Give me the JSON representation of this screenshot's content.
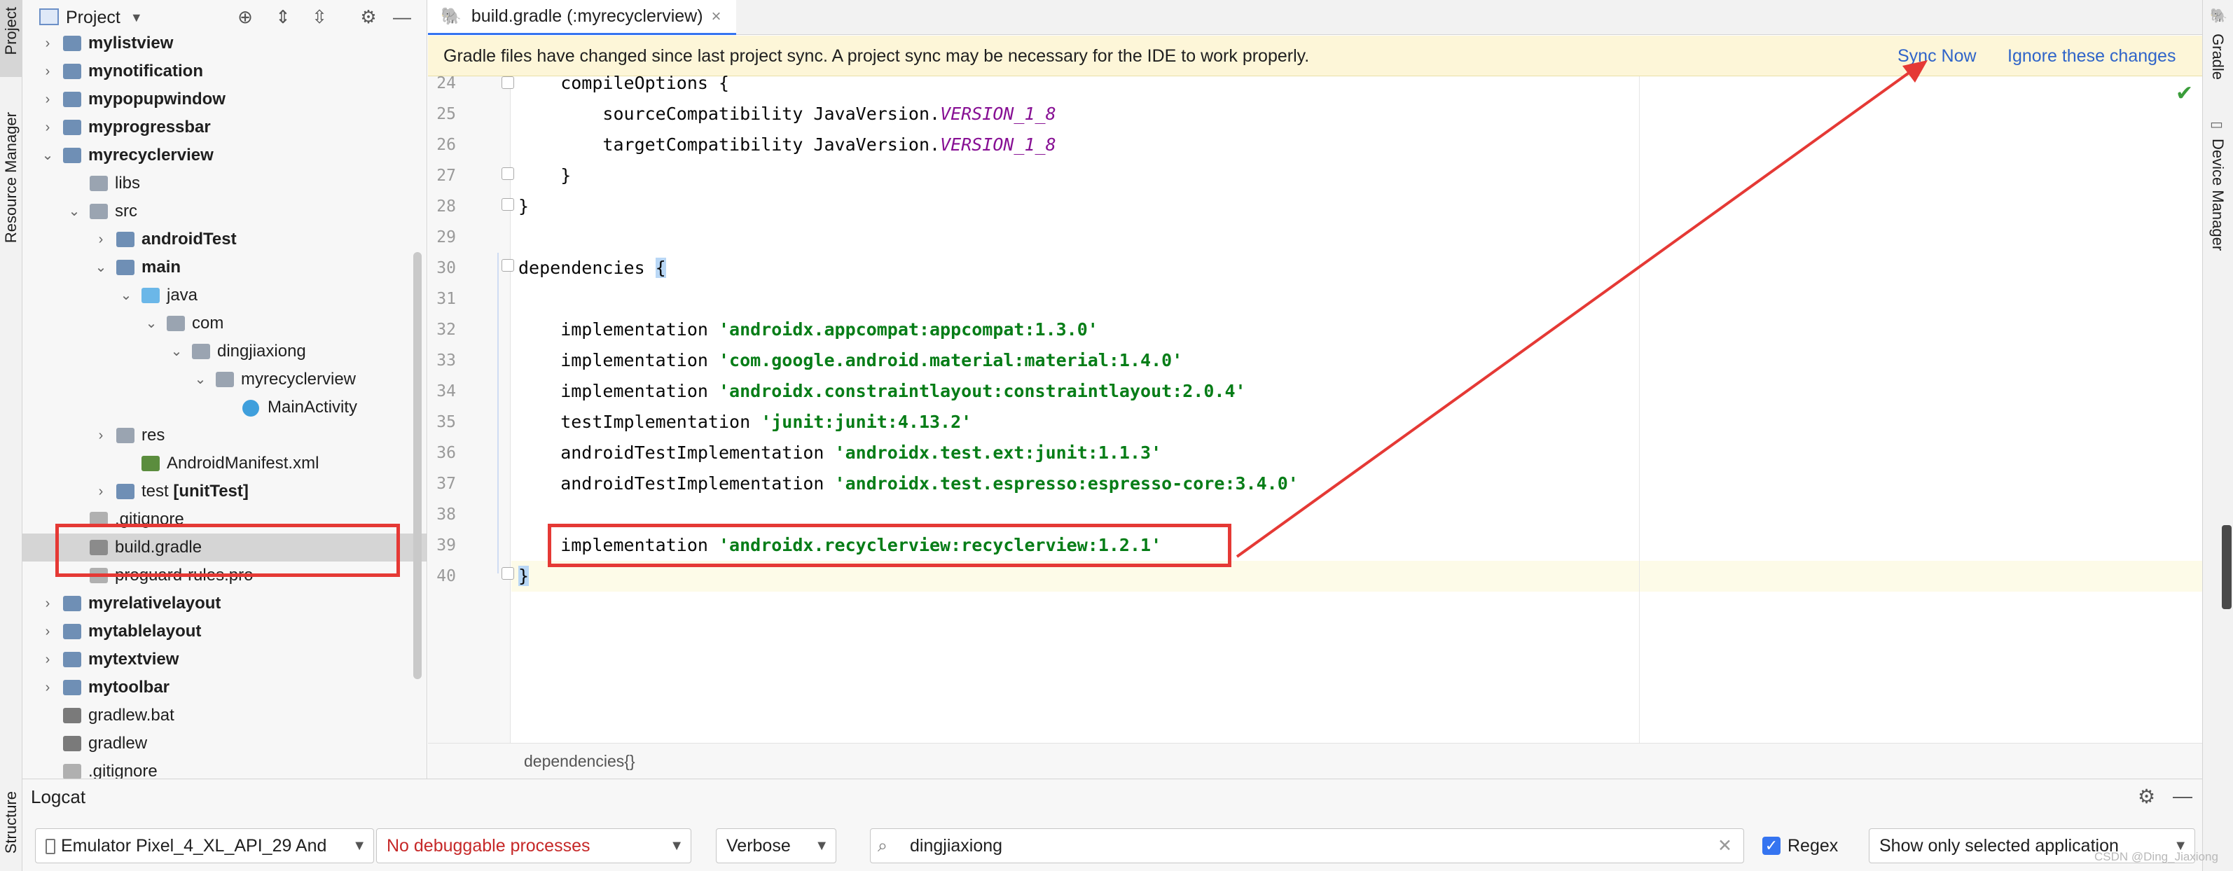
{
  "left_strip": {
    "project": "Project",
    "resource_manager": "Resource Manager",
    "structure": "Structure"
  },
  "project_panel": {
    "title": "Project",
    "tree": [
      {
        "label": "mylistview",
        "bold": true,
        "chevron": "›"
      },
      {
        "label": "mynotification",
        "bold": true,
        "chevron": "›"
      },
      {
        "label": "mypopupwindow",
        "bold": true,
        "chevron": "›"
      },
      {
        "label": "myprogressbar",
        "bold": true,
        "chevron": "›"
      },
      {
        "label": "myrecyclerview",
        "bold": true,
        "chevron": "⌄"
      },
      {
        "label": "libs",
        "bold": false,
        "chevron": ""
      },
      {
        "label": "src",
        "bold": false,
        "chevron": "⌄"
      },
      {
        "label": "androidTest",
        "bold": true,
        "chevron": "›"
      },
      {
        "label": "main",
        "bold": true,
        "chevron": "⌄"
      },
      {
        "label": "java",
        "bold": false,
        "chevron": "⌄"
      },
      {
        "label": "com",
        "bold": false,
        "chevron": "⌄"
      },
      {
        "label": "dingjiaxiong",
        "bold": false,
        "chevron": "⌄"
      },
      {
        "label": "myrecyclerview",
        "bold": false,
        "chevron": "⌄"
      },
      {
        "label": "MainActivity",
        "bold": false,
        "chevron": ""
      },
      {
        "label": "res",
        "bold": false,
        "chevron": "›"
      },
      {
        "label": "AndroidManifest.xml",
        "bold": false,
        "chevron": ""
      },
      {
        "label": "test",
        "suffix": " [unitTest]",
        "bold": false,
        "chevron": "›"
      },
      {
        "label": ".gitignore",
        "bold": false,
        "chevron": ""
      },
      {
        "label": "build.gradle",
        "bold": false,
        "chevron": ""
      },
      {
        "label": "proguard-rules.pro",
        "bold": false,
        "chevron": ""
      },
      {
        "label": "myrelativelayout",
        "bold": true,
        "chevron": "›"
      },
      {
        "label": "mytablelayout",
        "bold": true,
        "chevron": "›"
      },
      {
        "label": "mytextview",
        "bold": true,
        "chevron": "›"
      },
      {
        "label": "mytoolbar",
        "bold": true,
        "chevron": "›"
      },
      {
        "label": "gradlew.bat",
        "bold": false,
        "chevron": ""
      },
      {
        "label": "gradlew",
        "bold": false,
        "chevron": ""
      },
      {
        "label": ".gitignore",
        "bold": false,
        "chevron": ""
      }
    ]
  },
  "editor_tab": {
    "label": "build.gradle (:myrecyclerview)",
    "close": "×"
  },
  "banner": {
    "message": "Gradle files have changed since last project sync. A project sync may be necessary for the IDE to work properly.",
    "sync_now": "Sync Now",
    "ignore": "Ignore these changes"
  },
  "code_lines": [
    {
      "num": "24",
      "parts": [
        [
          "plain",
          "    compileOptions {"
        ]
      ]
    },
    {
      "num": "25",
      "parts": [
        [
          "plain",
          "        sourceCompatibility JavaVersion."
        ],
        [
          "const",
          "VERSION_1_8"
        ]
      ]
    },
    {
      "num": "26",
      "parts": [
        [
          "plain",
          "        targetCompatibility JavaVersion."
        ],
        [
          "const",
          "VERSION_1_8"
        ]
      ]
    },
    {
      "num": "27",
      "parts": [
        [
          "plain",
          "    }"
        ]
      ]
    },
    {
      "num": "28",
      "parts": [
        [
          "plain",
          "}"
        ]
      ]
    },
    {
      "num": "29",
      "parts": []
    },
    {
      "num": "30",
      "parts": [
        [
          "plain",
          "dependencies "
        ],
        [
          "brace",
          "{"
        ]
      ]
    },
    {
      "num": "31",
      "parts": []
    },
    {
      "num": "32",
      "parts": [
        [
          "plain",
          "    implementation "
        ],
        [
          "str",
          "'androidx.appcompat:appcompat:1.3.0'"
        ]
      ]
    },
    {
      "num": "33",
      "parts": [
        [
          "plain",
          "    implementation "
        ],
        [
          "str",
          "'com.google.android.material:material:1.4.0'"
        ]
      ]
    },
    {
      "num": "34",
      "parts": [
        [
          "plain",
          "    implementation "
        ],
        [
          "str",
          "'androidx.constraintlayout:constraintlayout:2.0.4'"
        ]
      ]
    },
    {
      "num": "35",
      "parts": [
        [
          "plain",
          "    testImplementation "
        ],
        [
          "str",
          "'junit:junit:4.13.2'"
        ]
      ]
    },
    {
      "num": "36",
      "parts": [
        [
          "plain",
          "    androidTestImplementation "
        ],
        [
          "str",
          "'androidx.test.ext:junit:1.1.3'"
        ]
      ]
    },
    {
      "num": "37",
      "parts": [
        [
          "plain",
          "    androidTestImplementation "
        ],
        [
          "str",
          "'androidx.test.espresso:espresso-core:3.4.0'"
        ]
      ]
    },
    {
      "num": "38",
      "parts": []
    },
    {
      "num": "39",
      "parts": [
        [
          "plain",
          "    implementation "
        ],
        [
          "str",
          "'androidx.recyclerview:recyclerview:1.2.1'"
        ]
      ]
    },
    {
      "num": "40",
      "parts": [
        [
          "brace",
          "}"
        ]
      ]
    }
  ],
  "breadcrumb": "dependencies{}",
  "right_strip": {
    "gradle": "Gradle",
    "device_manager": "Device Manager"
  },
  "logcat": {
    "title": "Logcat",
    "device": "Emulator Pixel_4_XL_API_29 And",
    "process": "No debuggable processes",
    "level": "Verbose",
    "search_value": "dingjiaxiong",
    "regex_label": "Regex",
    "filter": "Show only selected application"
  },
  "watermark": "CSDN @Ding_Jiaxiong",
  "colors": {
    "accent": "#3574f0",
    "annotation": "#e53935",
    "string": "#067d17",
    "constant": "#871094",
    "banner": "#fdf6d8"
  }
}
